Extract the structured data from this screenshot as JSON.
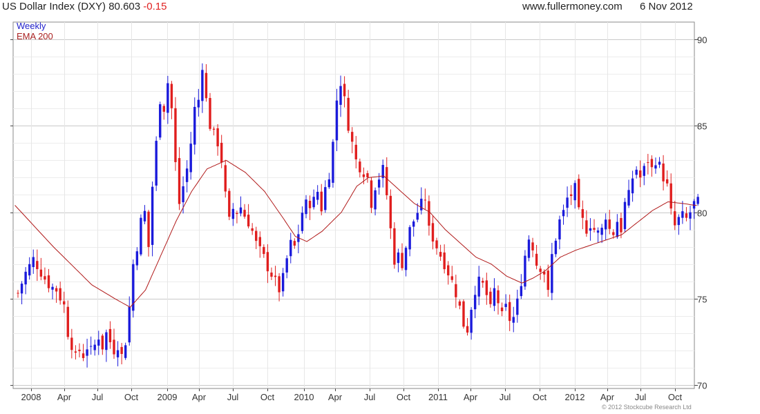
{
  "header": {
    "title": "US Dollar Index (DXY) 80.603",
    "change": "-0.15",
    "site": "www.fullermoney.com",
    "date": "6 Nov 2012"
  },
  "footer": {
    "copyright": "© 2012 Stockcube Research Ltd"
  },
  "colors": {
    "up": "#1a1adb",
    "down": "#e01e1e",
    "ema": "#b01818",
    "grid": "#d6d6d6",
    "frame": "#888888",
    "label_weekly": "#2222cc",
    "label_ema": "#aa2222"
  },
  "chart_data": {
    "type": "candlestick",
    "series_labels": [
      "Weekly",
      "EMA 200"
    ],
    "y_axis": {
      "min": 70,
      "max": 90,
      "ticks": [
        70,
        75,
        80,
        85,
        90
      ],
      "side": "right"
    },
    "x_labels": [
      "2008",
      "Apr",
      "Jul",
      "Oct",
      "2009",
      "Apr",
      "Jul",
      "Oct",
      "2010",
      "Apr",
      "Jul",
      "Oct",
      "2011",
      "Apr",
      "Jul",
      "Oct",
      "2012",
      "Apr",
      "Jul",
      "Oct"
    ],
    "grid": true,
    "close_path": [
      [
        0,
        75.3
      ],
      [
        2,
        76.5
      ],
      [
        4,
        77.3
      ],
      [
        6,
        76.5
      ],
      [
        8,
        75.8
      ],
      [
        10,
        75.5
      ],
      [
        12,
        74.6
      ],
      [
        13,
        73.0
      ],
      [
        14,
        72.3
      ],
      [
        15,
        71.6
      ],
      [
        16,
        72.0
      ],
      [
        17,
        71.7
      ],
      [
        18,
        72.2
      ],
      [
        19,
        72.0
      ],
      [
        20,
        72.3
      ],
      [
        21,
        72.8
      ],
      [
        22,
        72.2
      ],
      [
        23,
        73.0
      ],
      [
        24,
        72.5
      ],
      [
        25,
        72.0
      ],
      [
        26,
        72.3
      ],
      [
        27,
        71.7
      ],
      [
        28,
        72.5
      ],
      [
        29,
        74.5
      ],
      [
        30,
        77.0
      ],
      [
        31,
        78.0
      ],
      [
        32,
        79.5
      ],
      [
        33,
        80.0
      ],
      [
        34,
        78.0
      ],
      [
        35,
        81.5
      ],
      [
        36,
        84.0
      ],
      [
        37,
        86.5
      ],
      [
        38,
        86.0
      ],
      [
        39,
        87.5
      ],
      [
        40,
        86.0
      ],
      [
        41,
        82.8
      ],
      [
        42,
        80.5
      ],
      [
        43,
        81.5
      ],
      [
        44,
        82.5
      ],
      [
        45,
        84.0
      ],
      [
        46,
        86.0
      ],
      [
        47,
        86.5
      ],
      [
        48,
        88.5
      ],
      [
        49,
        86.5
      ],
      [
        50,
        85.0
      ],
      [
        51,
        84.5
      ],
      [
        52,
        84.0
      ],
      [
        53,
        83.0
      ],
      [
        54,
        81.0
      ],
      [
        55,
        79.5
      ],
      [
        56,
        80.2
      ],
      [
        57,
        80.0
      ],
      [
        58,
        80.3
      ],
      [
        59,
        79.8
      ],
      [
        60,
        79.4
      ],
      [
        61,
        78.9
      ],
      [
        62,
        78.2
      ],
      [
        63,
        77.8
      ],
      [
        64,
        77.4
      ],
      [
        65,
        76.8
      ],
      [
        66,
        76.4
      ],
      [
        67,
        76.0
      ],
      [
        68,
        75.5
      ],
      [
        69,
        76.2
      ],
      [
        70,
        77.3
      ],
      [
        71,
        78.2
      ],
      [
        72,
        78.0
      ],
      [
        73,
        78.8
      ],
      [
        74,
        80.0
      ],
      [
        75,
        80.5
      ],
      [
        76,
        80.5
      ],
      [
        77,
        80.7
      ],
      [
        78,
        81.2
      ],
      [
        79,
        80.2
      ],
      [
        80,
        81.4
      ],
      [
        81,
        82.2
      ],
      [
        82,
        84.0
      ],
      [
        83,
        86.5
      ],
      [
        84,
        87.5
      ],
      [
        85,
        86.5
      ],
      [
        86,
        85.0
      ],
      [
        87,
        84.0
      ],
      [
        88,
        83.0
      ],
      [
        89,
        82.6
      ],
      [
        90,
        82.3
      ],
      [
        91,
        82.0
      ],
      [
        92,
        80.5
      ],
      [
        93,
        81.5
      ],
      [
        94,
        82.0
      ],
      [
        95,
        82.5
      ],
      [
        96,
        81.0
      ],
      [
        97,
        79.0
      ],
      [
        98,
        77.2
      ],
      [
        99,
        77.5
      ],
      [
        100,
        77.0
      ],
      [
        101,
        78.0
      ],
      [
        102,
        79.0
      ],
      [
        103,
        79.5
      ],
      [
        104,
        80.0
      ],
      [
        105,
        80.5
      ],
      [
        106,
        80.8
      ],
      [
        107,
        79.0
      ],
      [
        108,
        78.5
      ],
      [
        109,
        78.0
      ],
      [
        110,
        77.5
      ],
      [
        111,
        77.0
      ],
      [
        112,
        76.5
      ],
      [
        113,
        76.0
      ],
      [
        114,
        75.3
      ],
      [
        115,
        74.5
      ],
      [
        116,
        73.5
      ],
      [
        117,
        73.2
      ],
      [
        118,
        74.5
      ],
      [
        119,
        75.5
      ],
      [
        120,
        76.0
      ],
      [
        121,
        75.8
      ],
      [
        122,
        75.2
      ],
      [
        123,
        74.4
      ],
      [
        124,
        75.5
      ],
      [
        125,
        74.8
      ],
      [
        126,
        74.0
      ],
      [
        127,
        74.5
      ],
      [
        128,
        73.8
      ],
      [
        129,
        73.9
      ],
      [
        130,
        74.8
      ],
      [
        131,
        76.0
      ],
      [
        132,
        77.5
      ],
      [
        133,
        78.5
      ],
      [
        134,
        78.0
      ],
      [
        135,
        77.0
      ],
      [
        136,
        76.8
      ],
      [
        137,
        76.5
      ],
      [
        138,
        75.3
      ],
      [
        139,
        77.5
      ],
      [
        140,
        78.5
      ],
      [
        141,
        79.5
      ],
      [
        142,
        80.0
      ],
      [
        143,
        80.8
      ],
      [
        144,
        81.0
      ],
      [
        145,
        81.4
      ],
      [
        146,
        80.0
      ],
      [
        147,
        79.5
      ],
      [
        148,
        79.0
      ],
      [
        149,
        79.3
      ],
      [
        150,
        79.0
      ],
      [
        151,
        78.8
      ],
      [
        152,
        79.0
      ],
      [
        153,
        79.8
      ],
      [
        154,
        79.0
      ],
      [
        155,
        78.8
      ],
      [
        156,
        79.5
      ],
      [
        157,
        79.0
      ],
      [
        158,
        80.5
      ],
      [
        159,
        81.0
      ],
      [
        160,
        82.0
      ],
      [
        161,
        82.5
      ],
      [
        162,
        82.0
      ],
      [
        163,
        82.5
      ],
      [
        164,
        83.0
      ],
      [
        165,
        82.5
      ],
      [
        166,
        83.0
      ],
      [
        167,
        82.7
      ],
      [
        168,
        82.0
      ],
      [
        169,
        81.5
      ],
      [
        170,
        80.0
      ],
      [
        171,
        79.2
      ],
      [
        172,
        79.6
      ],
      [
        173,
        79.8
      ],
      [
        174,
        79.6
      ],
      [
        175,
        80.0
      ],
      [
        176,
        80.5
      ],
      [
        177,
        80.6
      ]
    ],
    "ema_points": [
      [
        0,
        80.4
      ],
      [
        10,
        78.0
      ],
      [
        20,
        75.8
      ],
      [
        26,
        75.0
      ],
      [
        30,
        74.5
      ],
      [
        34,
        75.5
      ],
      [
        38,
        77.5
      ],
      [
        42,
        79.5
      ],
      [
        46,
        81.2
      ],
      [
        50,
        82.5
      ],
      [
        55,
        83.0
      ],
      [
        60,
        82.3
      ],
      [
        65,
        81.2
      ],
      [
        70,
        79.6
      ],
      [
        73,
        78.6
      ],
      [
        76,
        78.3
      ],
      [
        80,
        78.9
      ],
      [
        85,
        80.0
      ],
      [
        89,
        81.5
      ],
      [
        92,
        82.0
      ],
      [
        96,
        82.1
      ],
      [
        100,
        81.3
      ],
      [
        104,
        80.5
      ],
      [
        108,
        80.0
      ],
      [
        112,
        79.0
      ],
      [
        116,
        78.2
      ],
      [
        120,
        77.4
      ],
      [
        124,
        77.0
      ],
      [
        128,
        76.3
      ],
      [
        132,
        75.9
      ],
      [
        135,
        76.2
      ],
      [
        138,
        76.6
      ],
      [
        142,
        77.4
      ],
      [
        146,
        77.8
      ],
      [
        150,
        78.1
      ],
      [
        154,
        78.4
      ],
      [
        158,
        78.7
      ],
      [
        162,
        79.4
      ],
      [
        166,
        80.1
      ],
      [
        170,
        80.6
      ],
      [
        174,
        80.5
      ],
      [
        177,
        80.4
      ]
    ]
  }
}
